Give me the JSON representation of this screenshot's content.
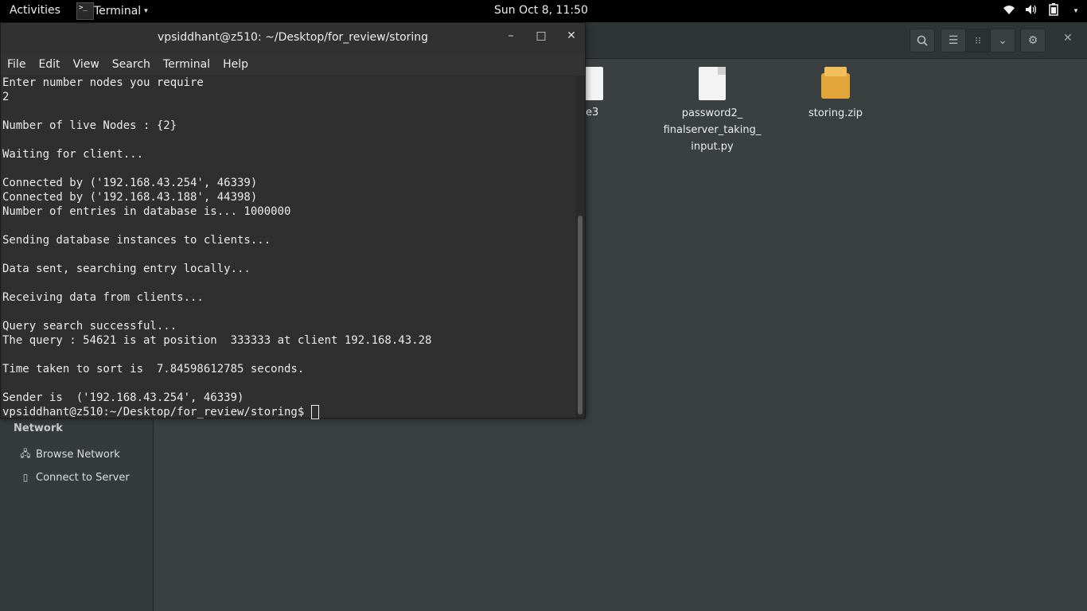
{
  "topbar": {
    "activities": "Activities",
    "app_label": "Terminal",
    "app_icon_text": ">_",
    "caret": "▾",
    "clock": "Sun Oct  8, 11:50",
    "icons": [
      "wifi-icon",
      "volume-icon",
      "battery-icon"
    ]
  },
  "terminal": {
    "title": "vpsiddhant@z510: ~/Desktop/for_review/storing",
    "buttons": {
      "minimize": "–",
      "maximize": "□",
      "close": "✕"
    },
    "menu": [
      "File",
      "Edit",
      "View",
      "Search",
      "Terminal",
      "Help"
    ],
    "lines": [
      "Enter number nodes you require",
      "2",
      "",
      "Number of live Nodes : {2}",
      "",
      "Waiting for client...",
      "",
      "Connected by ('192.168.43.254', 46339)",
      "Connected by ('192.168.43.188', 44398)",
      "Number of entries in database is... 1000000",
      "",
      "Sending database instances to clients...",
      "",
      "Data sent, searching entry locally...",
      "",
      "Receiving data from clients...",
      "",
      "Query search successful...",
      "The query : 54621 is at position  333333 at client 192.168.43.28",
      "",
      "Time taken to sort is  7.84598612785 seconds.",
      "",
      "Sender is  ('192.168.43.254', 46339)"
    ],
    "prompt": "vpsiddhant@z510:~/Desktop/for_review/storing$ "
  },
  "files": {
    "sidebar": {
      "network_heading": "Network",
      "browse_network": "Browse Network",
      "connect_server": "Connect to Server"
    },
    "items": [
      {
        "name_partial": "e3"
      },
      {
        "name_line1": "password2_",
        "name_line2": "finalserver_taking_",
        "name_line3": "input.py"
      },
      {
        "name": "storing.zip"
      }
    ]
  }
}
